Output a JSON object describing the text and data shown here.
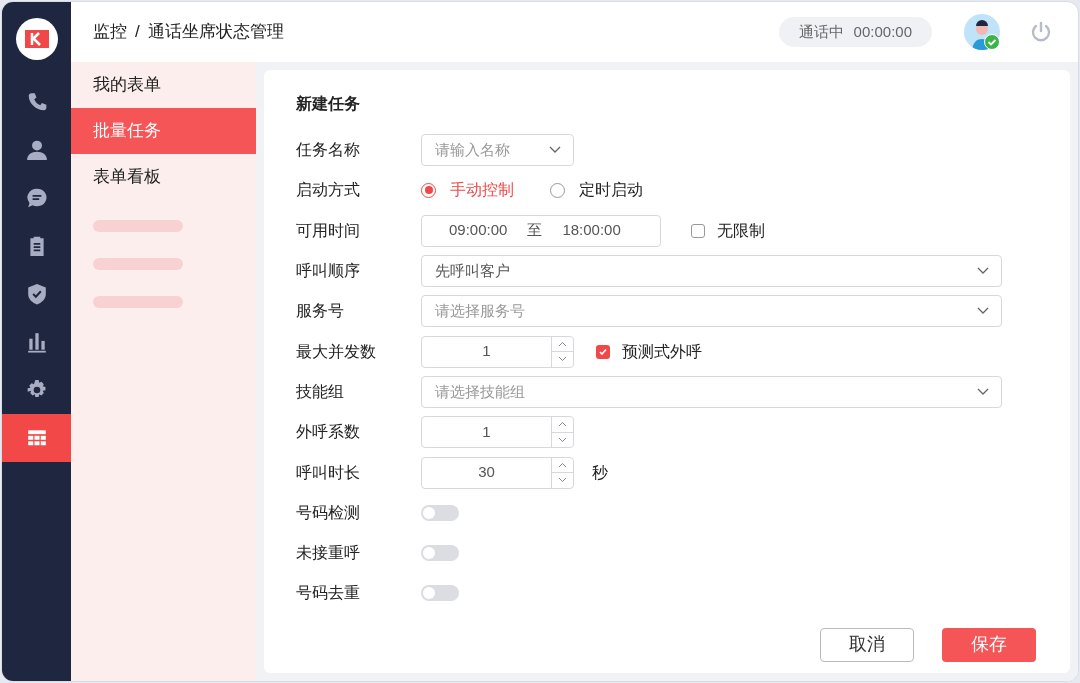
{
  "breadcrumb": {
    "section": "监控",
    "separator": "/",
    "page": "通话坐席状态管理"
  },
  "call_status": {
    "label": "通话中",
    "timer": "00:00:00"
  },
  "user": {
    "online": true
  },
  "nav": [
    {
      "selected": false
    },
    {
      "selected": false
    },
    {
      "selected": false
    },
    {
      "selected": false
    },
    {
      "selected": false
    },
    {
      "selected": false
    },
    {
      "selected": false
    },
    {
      "selected": true
    }
  ],
  "menu": [
    {
      "label": "我的表单",
      "selected": false
    },
    {
      "label": "批量任务",
      "selected": true
    },
    {
      "label": "表单看板",
      "selected": false
    }
  ],
  "form": {
    "title": "新建任务",
    "fields": [
      {
        "kind": "combo",
        "label": "任务名称",
        "placeholder": "请输入名称"
      },
      {
        "kind": "radio",
        "label": "启动方式",
        "options": [
          {
            "label": "手动控制",
            "selected": true
          },
          {
            "label": "定时启动",
            "selected": false
          }
        ]
      },
      {
        "kind": "timerange",
        "label": "可用时间",
        "start": "09:00:00",
        "separator": "至",
        "end": "18:00:00",
        "checkbox": {
          "label": "无限制",
          "checked": false
        }
      },
      {
        "kind": "select",
        "label": "呼叫顺序",
        "value": "先呼叫客户"
      },
      {
        "kind": "select",
        "label": "服务号",
        "placeholder": "请选择服务号"
      },
      {
        "kind": "number",
        "label": "最大并发数",
        "value": "1",
        "checkbox": {
          "label": "预测式外呼",
          "checked": true
        }
      },
      {
        "kind": "select",
        "label": "技能组",
        "placeholder": "请选择技能组"
      },
      {
        "kind": "number",
        "label": "外呼系数",
        "value": "1"
      },
      {
        "kind": "number",
        "label": "呼叫时长",
        "value": "30",
        "suffix": "秒"
      },
      {
        "kind": "toggle",
        "label": "号码检测",
        "on": false
      },
      {
        "kind": "toggle",
        "label": "未接重呼",
        "on": false
      },
      {
        "kind": "toggle",
        "label": "号码去重",
        "on": false
      }
    ],
    "buttons": [
      {
        "label": "取消",
        "kind": "secondary"
      },
      {
        "label": "保存",
        "kind": "primary"
      }
    ]
  }
}
